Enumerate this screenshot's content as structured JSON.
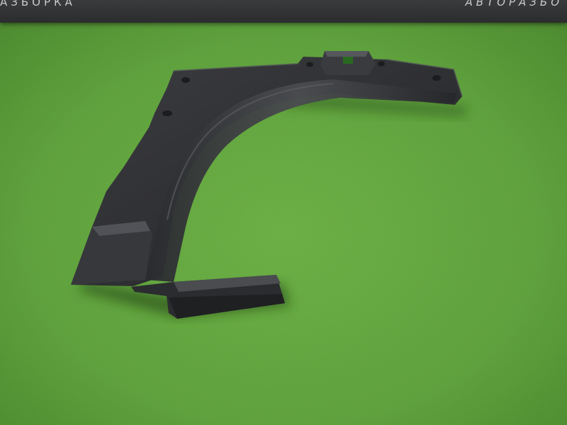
{
  "photo": {
    "subject_icon": "plastic-trim-panel",
    "colors": {
      "grass": "#5fa838",
      "grass_dark": "#3f7f22",
      "panel": "#2f3033",
      "panel_light": "#45474b",
      "banner": "#333436"
    }
  },
  "watermark": {
    "left_text": "АЗБОРКА",
    "right_text": "АВТОРАЗБО"
  }
}
